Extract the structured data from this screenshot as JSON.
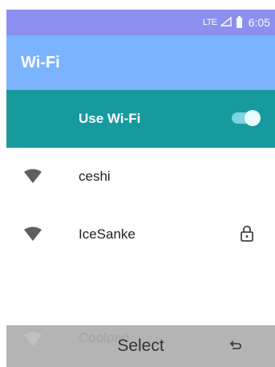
{
  "status_bar": {
    "network": "LTE",
    "time": "6:05"
  },
  "app_bar": {
    "title": "Wi-Fi"
  },
  "wifi_toggle": {
    "label": "Use Wi-Fi",
    "state": "on",
    "color_accent": "#169a9e"
  },
  "networks": [
    {
      "name": "ceshi",
      "secured": false,
      "icon": "wifi-signal-icon"
    },
    {
      "name": "IceSanke",
      "secured": true,
      "icon": "wifi-signal-icon"
    },
    {
      "name": "Coolpad",
      "secured": false,
      "icon": "wifi-signal-icon"
    }
  ],
  "softkeys": {
    "center": "Select",
    "right_icon": "back-icon"
  }
}
